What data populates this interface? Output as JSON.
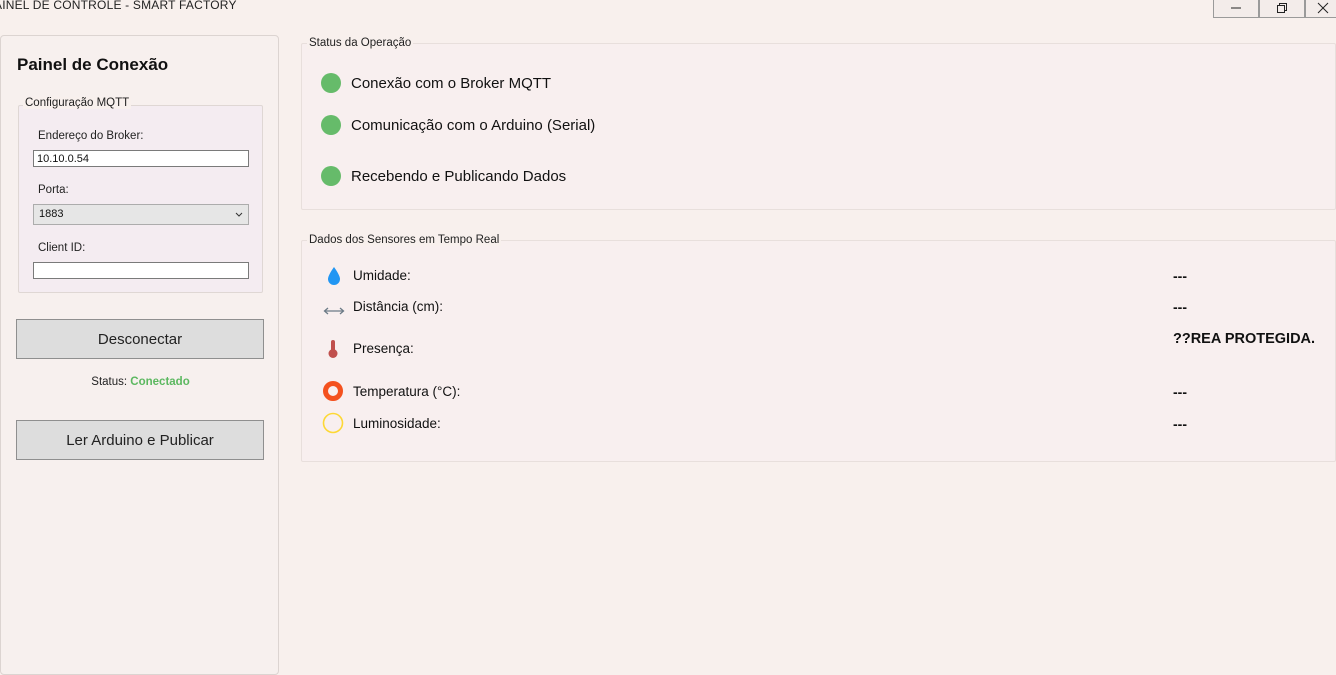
{
  "window": {
    "title": "AINEL DE CONTROLE - SMART FACTORY",
    "minimize_icon": "minimize-icon",
    "restore_icon": "restore-icon",
    "close_icon": "close-icon"
  },
  "sidebar": {
    "title": "Painel de Conexão",
    "mqtt_group": {
      "legend": "Configuração MQTT",
      "broker_label": "Endereço do Broker:",
      "broker_value": "10.10.0.54",
      "port_label": "Porta:",
      "port_value": "1883",
      "client_id_label": "Client ID:",
      "client_id_value": ""
    },
    "disconnect_button": "Desconectar",
    "status_label": "Status:",
    "status_value": "Conectado",
    "read_button": "Ler Arduino e Publicar"
  },
  "operation_status": {
    "legend": "Status da Operação",
    "items": [
      {
        "label": "Conexão com o Broker MQTT",
        "color": "#66bb6a"
      },
      {
        "label": "Comunicação com o Arduino (Serial)",
        "color": "#66bb6a"
      },
      {
        "label": "Recebendo e Publicando Dados",
        "color": "#66bb6a"
      }
    ]
  },
  "sensors": {
    "legend": "Dados dos Sensores em Tempo Real",
    "items": [
      {
        "label": "Umidade:",
        "value": "---",
        "icon": "water-drop-icon"
      },
      {
        "label": "Distância (cm):",
        "value": "---",
        "icon": "distance-arrows-icon"
      },
      {
        "label": "Presença:",
        "value": "??REA PROTEGIDA.",
        "icon": "thermometer-icon"
      },
      {
        "label": "Temperatura (°C):",
        "value": "---",
        "icon": "temperature-ring-icon"
      },
      {
        "label": "Luminosidade:",
        "value": "---",
        "icon": "light-ring-icon"
      }
    ]
  },
  "colors": {
    "background": "#f8f0ed",
    "status_connected": "#5cb860",
    "status_dot": "#66bb6a",
    "water": "#2196f3",
    "arrow": "#6b7a86",
    "thermometer": "#c0504d",
    "temperature_ring": "#f4511e",
    "light_ring": "#fdd835"
  }
}
